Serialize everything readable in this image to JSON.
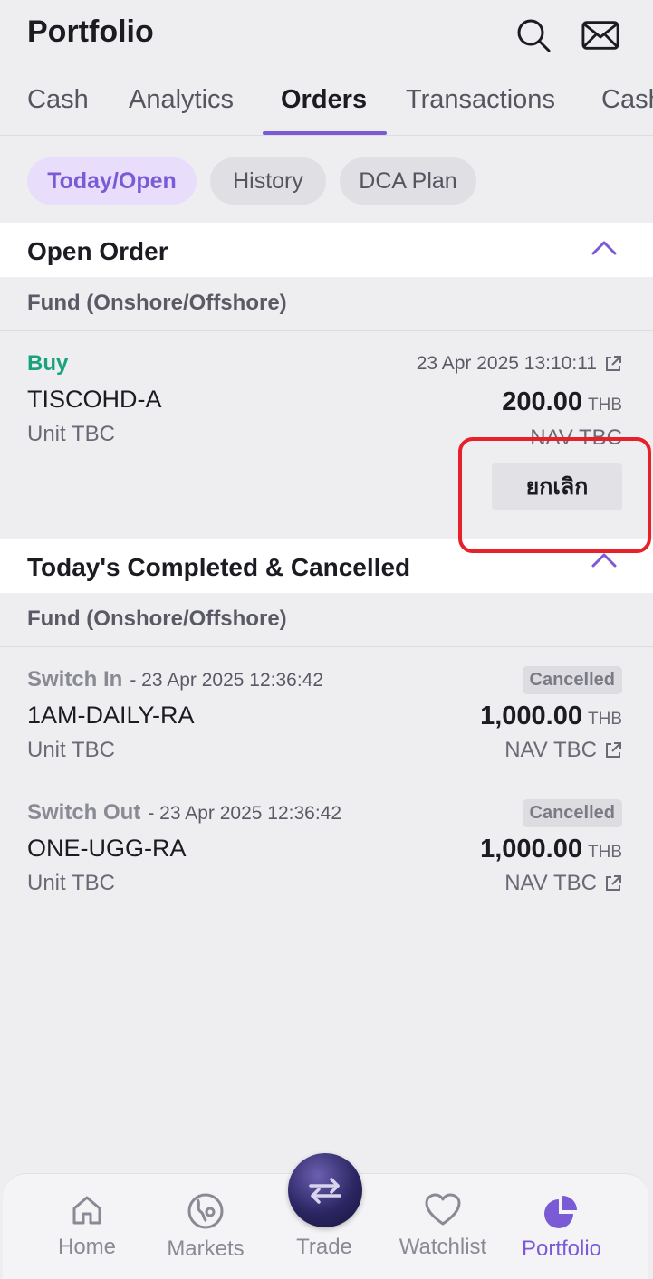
{
  "header": {
    "title": "Portfolio"
  },
  "tabs": [
    {
      "label": "Cash"
    },
    {
      "label": "Analytics"
    },
    {
      "label": "Orders"
    },
    {
      "label": "Transactions"
    },
    {
      "label": "Cash"
    }
  ],
  "chips": [
    {
      "label": "Today/Open"
    },
    {
      "label": "History"
    },
    {
      "label": "DCA Plan"
    }
  ],
  "open_section": {
    "title": "Open Order",
    "sub": "Fund (Onshore/Offshore)",
    "order": {
      "side": "Buy",
      "datetime": "23 Apr 2025 13:10:11",
      "fund": "TISCOHD-A",
      "unit": "Unit TBC",
      "amount": "200.00",
      "currency": "THB",
      "nav": "NAV TBC",
      "cancel_label": "ยกเลิก"
    }
  },
  "completed_section": {
    "title": "Today's Completed & Cancelled",
    "sub": "Fund (Onshore/Offshore)",
    "orders": [
      {
        "side": "Switch In",
        "datetime": "- 23 Apr 2025 12:36:42",
        "status": "Cancelled",
        "fund": "1AM-DAILY-RA",
        "unit": "Unit TBC",
        "amount": "1,000.00",
        "currency": "THB",
        "nav": "NAV TBC"
      },
      {
        "side": "Switch Out",
        "datetime": "- 23 Apr 2025 12:36:42",
        "status": "Cancelled",
        "fund": "ONE-UGG-RA",
        "unit": "Unit TBC",
        "amount": "1,000.00",
        "currency": "THB",
        "nav": "NAV TBC"
      }
    ]
  },
  "bottom_nav": [
    {
      "label": "Home",
      "icon": "home-icon"
    },
    {
      "label": "Markets",
      "icon": "markets-icon"
    },
    {
      "label": "Trade",
      "icon": "trade-icon"
    },
    {
      "label": "Watchlist",
      "icon": "heart-icon"
    },
    {
      "label": "Portfolio",
      "icon": "pie-chart-icon"
    }
  ],
  "colors": {
    "accent": "#7b5ad6",
    "buy": "#18a27d",
    "highlight": "#e8202a"
  }
}
